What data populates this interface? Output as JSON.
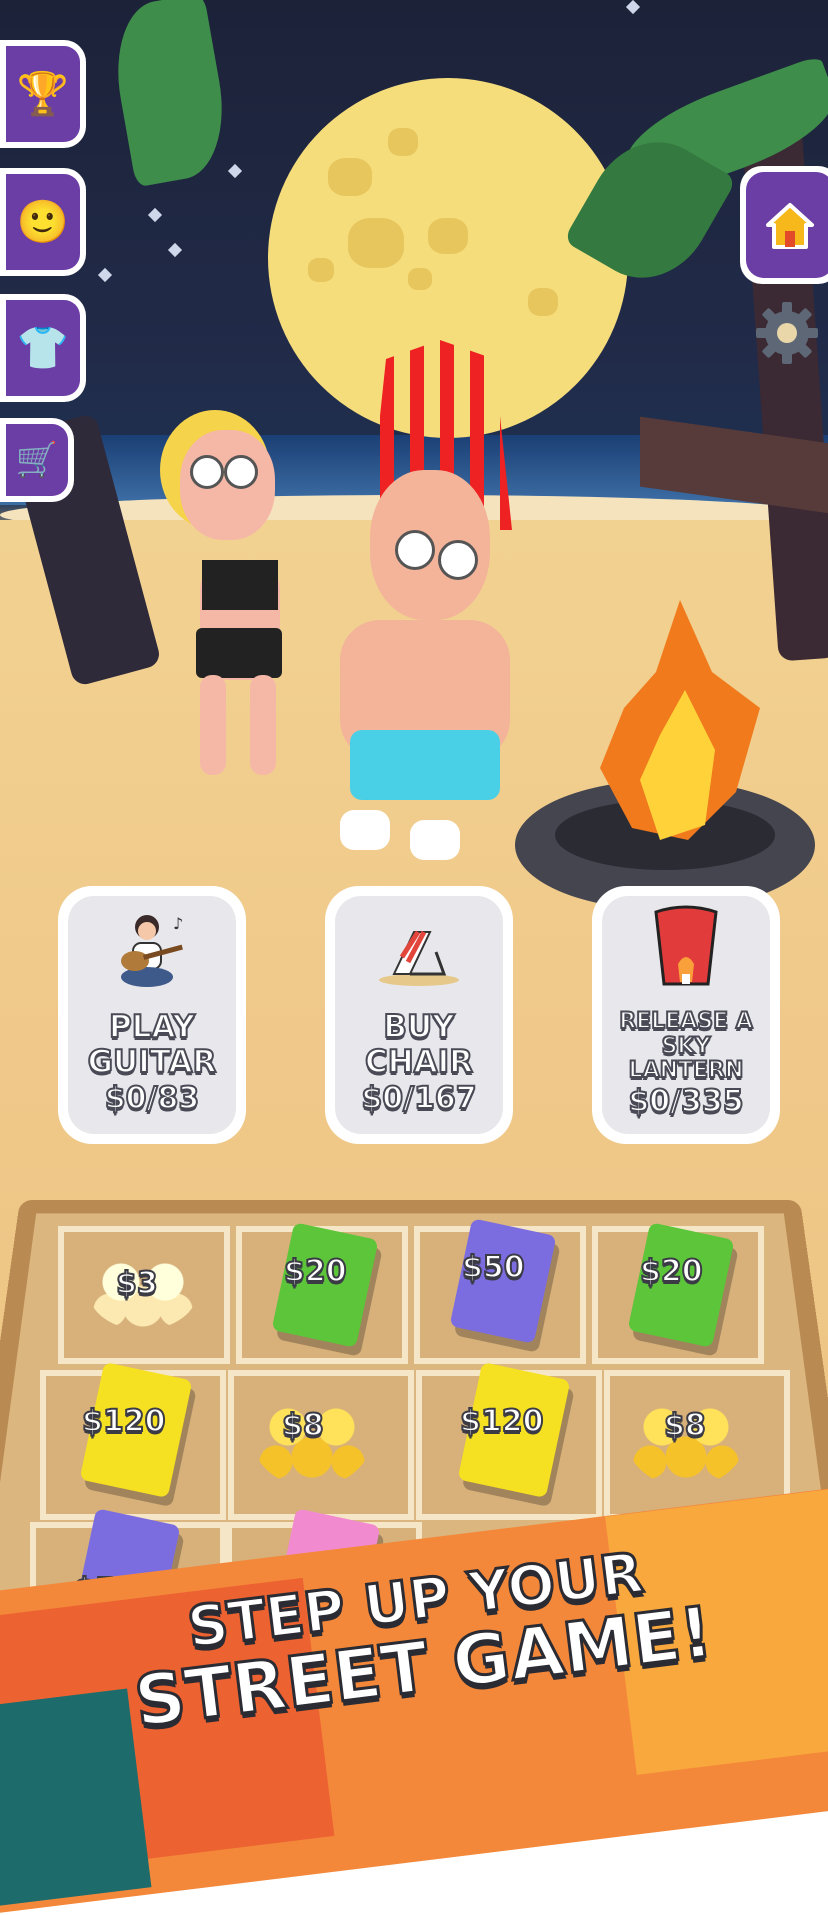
{
  "side_menu": {
    "items": [
      {
        "name": "trophy",
        "icon": "trophy-icon",
        "glyph": "🏆"
      },
      {
        "name": "level-up",
        "icon": "level-up-icon",
        "glyph": "🙂"
      },
      {
        "name": "outfit",
        "icon": "tshirt-icon",
        "glyph": "👕"
      },
      {
        "name": "shop",
        "icon": "cart-icon",
        "glyph": "🛒"
      }
    ]
  },
  "right_menu": {
    "home_icon": "home-icon",
    "settings_icon": "gear-icon"
  },
  "actions": [
    {
      "title": "PLAY\nGUITAR",
      "price": "$0/83",
      "icon": "guitar-player-icon"
    },
    {
      "title": "BUY\nCHAIR",
      "price": "$0/167",
      "icon": "beach-chair-icon"
    },
    {
      "title": "RELEASE A\nSKY LANTERN",
      "price": "$0/335",
      "icon": "sky-lantern-icon"
    }
  ],
  "board": {
    "items": [
      {
        "label": "$3",
        "kind": "coins-silver"
      },
      {
        "label": "$20",
        "kind": "bill",
        "color": "#5cc53a"
      },
      {
        "label": "$50",
        "kind": "bill",
        "color": "#7b6de0"
      },
      {
        "label": "$20",
        "kind": "bill",
        "color": "#5cc53a"
      },
      {
        "label": "$120",
        "kind": "bill",
        "color": "#f5e021"
      },
      {
        "label": "$8",
        "kind": "coins"
      },
      {
        "label": "$120",
        "kind": "bill",
        "color": "#f5e021"
      },
      {
        "label": "$8",
        "kind": "coins"
      },
      {
        "label": "$50",
        "kind": "bill",
        "color": "#7b6de0"
      },
      {
        "label": "",
        "kind": "bill",
        "color": "#f28ad0"
      }
    ]
  },
  "tagline": {
    "line1": "STEP UP YOUR",
    "line2": "STREET GAME!"
  },
  "colors": {
    "menu_purple": "#6b3ea5",
    "card_bg": "#e8e8ec",
    "banner_orange": "#f4883a"
  }
}
